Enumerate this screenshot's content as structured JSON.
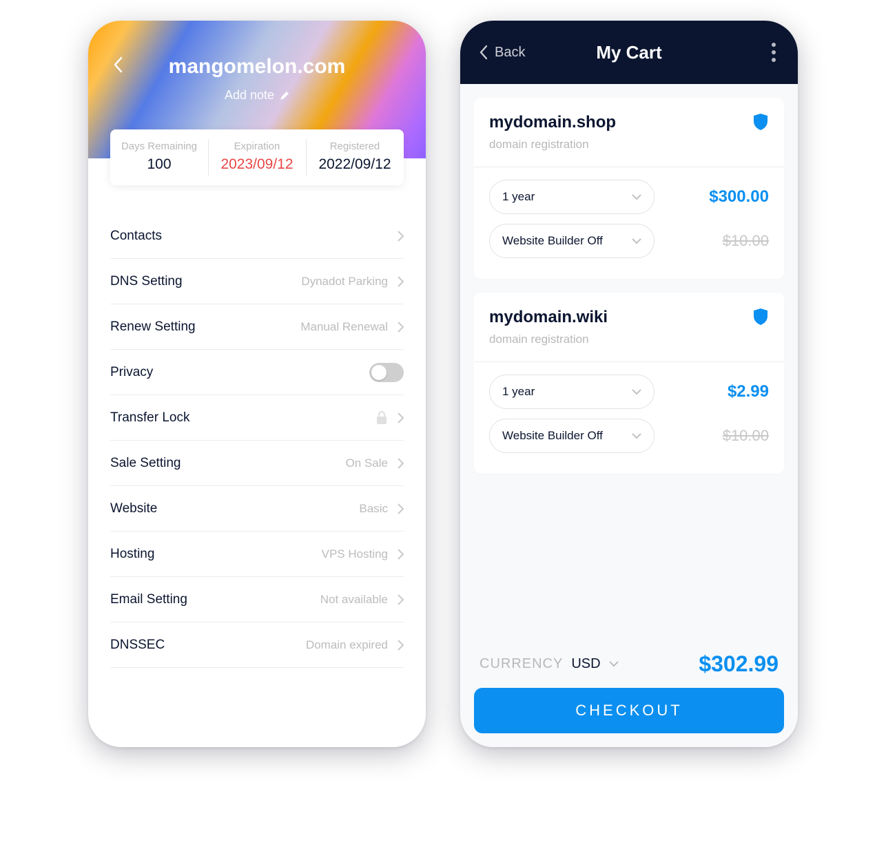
{
  "left": {
    "title": "mangomelon.com",
    "addnote": "Add note",
    "stats": {
      "days_label": "Days Remaining",
      "days_value": "100",
      "exp_label": "Expiration",
      "exp_value": "2023/09/12",
      "reg_label": "Registered",
      "reg_value": "2022/09/12"
    },
    "rows": {
      "contacts": "Contacts",
      "dns": "DNS Setting",
      "dns_val": "Dynadot Parking",
      "renew": "Renew Setting",
      "renew_val": "Manual Renewal",
      "privacy": "Privacy",
      "transfer": "Transfer Lock",
      "sale": "Sale Setting",
      "sale_val": "On Sale",
      "website": "Website",
      "website_val": "Basic",
      "hosting": "Hosting",
      "hosting_val": "VPS Hosting",
      "email": "Email Setting",
      "email_val": "Not available",
      "dnssec": "DNSSEC",
      "dnssec_val": "Domain expired"
    }
  },
  "right": {
    "back": "Back",
    "title": "My Cart",
    "items": [
      {
        "name": "mydomain.shop",
        "sub": "domain registration",
        "term": "1 year",
        "price": "$300.00",
        "builder": "Website Builder Off",
        "builder_price": "$10.00"
      },
      {
        "name": "mydomain.wiki",
        "sub": "domain registration",
        "term": "1 year",
        "price": "$2.99",
        "builder": "Website Builder Off",
        "builder_price": "$10.00"
      }
    ],
    "currency_label": "CURRENCY",
    "currency_value": "USD",
    "total": "$302.99",
    "checkout": "CHECKOUT"
  }
}
